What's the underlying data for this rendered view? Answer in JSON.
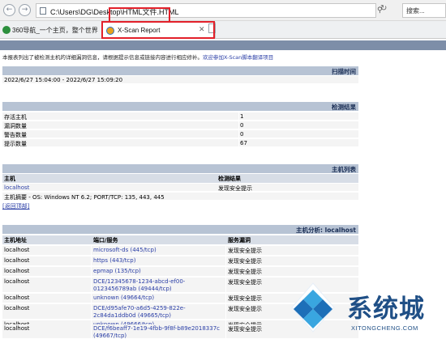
{
  "browser": {
    "address": "C:\\Users\\DG\\Desktop\\HTML文件.HTML",
    "search_placeholder": "搜索...",
    "tabs": [
      {
        "label": "360导航_一个主页，整个世界"
      },
      {
        "label": "X-Scan Report"
      }
    ]
  },
  "report": {
    "intro_text": "本报表列出了被检测主机的详细漏洞信息，请根据提示信息或链接内容进行相应修补。",
    "intro_link": "欢迎参加X-Scan脚本翻译项目",
    "scan_time": {
      "header": "扫描时间",
      "value": "2022/6/27 15:04:00 - 2022/6/27 15:09:20"
    },
    "results": {
      "header": "检测结果",
      "rows": [
        {
          "label": "存活主机",
          "value": "1"
        },
        {
          "label": "漏洞数量",
          "value": "0"
        },
        {
          "label": "警告数量",
          "value": "0"
        },
        {
          "label": "提示数量",
          "value": "67"
        }
      ]
    },
    "host_list": {
      "header": "主机列表",
      "col_host": "主机",
      "col_result": "检测结果",
      "host": "localhost",
      "result": "发现安全提示",
      "summary": "主机摘要 - OS: Windows NT 6.2; PORT/TCP: 135, 443, 445",
      "back_link": "[返回顶部]"
    },
    "host_analysis": {
      "header": "主机分析: localhost",
      "col_addr": "主机地址",
      "col_port": "端口/服务",
      "col_vuln": "服务漏洞",
      "rows": [
        {
          "addr": "localhost",
          "port": "microsoft-ds (445/tcp)",
          "vuln": "发现安全提示"
        },
        {
          "addr": "localhost",
          "port": "https (443/tcp)",
          "vuln": "发现安全提示"
        },
        {
          "addr": "localhost",
          "port": "epmap (135/tcp)",
          "vuln": "发现安全提示"
        },
        {
          "addr": "localhost",
          "port": "DCE/12345678-1234-abcd-ef00-0123456789ab (49444/tcp)",
          "vuln": "发现安全提示"
        },
        {
          "addr": "localhost",
          "port": "unknown (49664/tcp)",
          "vuln": "发现安全提示"
        },
        {
          "addr": "localhost",
          "port": "DCE/d95afe70-a6d5-4259-822e-2c84da1ddb0d (49665/tcp)",
          "vuln": "发现安全提示"
        },
        {
          "addr": "localhost",
          "port": "unknown (49666/tcp)",
          "vuln": "发现安全提示"
        },
        {
          "addr": "localhost",
          "port": "DCE/f6beaff7-1e19-4fbb-9f8f-b89e2018337c (49667/tcp)",
          "vuln": "发现安全提示"
        }
      ]
    }
  },
  "watermark": {
    "title": "系统城",
    "subtitle": "XITONGCHENG.COM"
  },
  "colors": {
    "highlight": "#e2202a",
    "section_header": "#b7c3d4",
    "link": "#2a3ea6",
    "watermark": "#1f4f86"
  }
}
